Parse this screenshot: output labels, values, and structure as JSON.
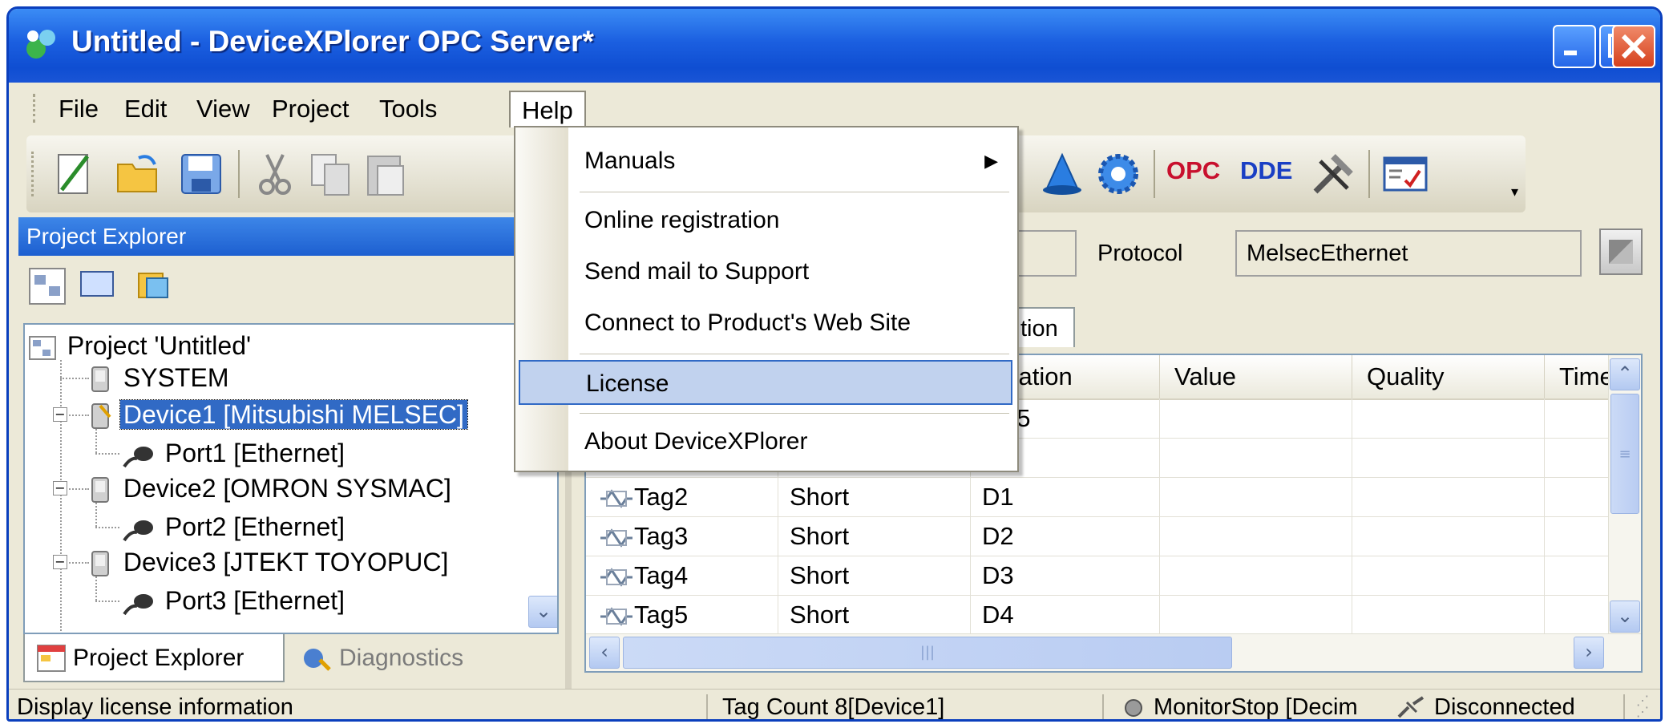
{
  "window": {
    "title": "Untitled - DeviceXPlorer OPC Server*",
    "colors": {
      "titlebar": "#1b5fe0",
      "face": "#ece9d8",
      "selection": "#316ac5",
      "menu_highlight": "#c1d2ee"
    }
  },
  "menubar": {
    "items": [
      {
        "label": "File"
      },
      {
        "label": "Edit"
      },
      {
        "label": "View"
      },
      {
        "label": "Project"
      },
      {
        "label": "Tools"
      },
      {
        "label": "Help",
        "open": true
      }
    ]
  },
  "toolbar": {
    "icons": [
      "new-icon",
      "open-folder-icon",
      "save-icon",
      "cut-icon",
      "copy-icon",
      "paste-icon",
      "delete-icon",
      "wizard-icon",
      "settings-gear-icon",
      "tools-icon",
      "monitor-icon"
    ],
    "opc_label": "OPC",
    "dde_label": "DDE"
  },
  "help_menu": {
    "items": [
      {
        "label": "Manuals",
        "submenu": true
      },
      {
        "label": "Online registration"
      },
      {
        "label": "Send mail to Support"
      },
      {
        "label": "Connect to Product's Web Site"
      },
      {
        "label": "License",
        "highlighted": true
      },
      {
        "label": "About DeviceXPlorer"
      }
    ]
  },
  "project_explorer": {
    "title": "Project Explorer",
    "tree": [
      {
        "label": "Project 'Untitled'",
        "icon": "project-icon"
      },
      {
        "label": "SYSTEM",
        "icon": "device-icon"
      },
      {
        "label": "Device1 [Mitsubishi MELSEC]",
        "icon": "device-icon",
        "selected": true
      },
      {
        "label": "Port1 [Ethernet]",
        "icon": "port-icon"
      },
      {
        "label": "Device2 [OMRON SYSMAC]",
        "icon": "device-icon"
      },
      {
        "label": "Port2 [Ethernet]",
        "icon": "port-icon"
      },
      {
        "label": "Device3 [JTEKT TOYOPUC]",
        "icon": "device-icon"
      },
      {
        "label": "Port3 [Ethernet]",
        "icon": "port-icon"
      }
    ],
    "tabs": [
      {
        "label": "Project Explorer",
        "active": true
      },
      {
        "label": "Diagnostics",
        "active": false
      }
    ]
  },
  "device_panel": {
    "protocol_label": "Protocol",
    "protocol_value": "MelsecEthernet",
    "tab_partial": "tion",
    "columns": [
      "cation",
      "Value",
      "Quality",
      "Time"
    ],
    "rows": [
      {
        "name": "",
        "type": "",
        "address": "25"
      },
      {
        "name": "",
        "type": "",
        "address": ""
      },
      {
        "name": "Tag2",
        "type": "Short",
        "address": "D1"
      },
      {
        "name": "Tag3",
        "type": "Short",
        "address": "D2"
      },
      {
        "name": "Tag4",
        "type": "Short",
        "address": "D3"
      },
      {
        "name": "Tag5",
        "type": "Short",
        "address": "D4"
      }
    ]
  },
  "statusbar": {
    "message": "Display license information",
    "tag_count": "Tag Count 8[Device1]",
    "monitor": "MonitorStop [Decim",
    "connection": "Disconnected"
  }
}
